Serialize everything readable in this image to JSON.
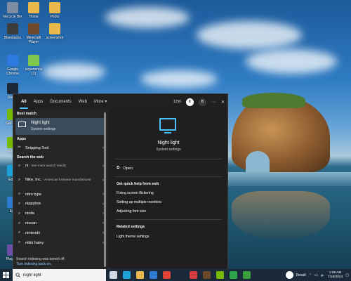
{
  "desktop": {
    "icons": [
      {
        "label": "Recycle Bin",
        "color": "#7d8ea0"
      },
      {
        "label": "Home",
        "color": "#e8b84a"
      },
      {
        "label": "Photo",
        "color": "#e8b84a"
      },
      {
        "label": "Bluestacks",
        "color": "#3c3c3c"
      },
      {
        "label": "Minecraft Player",
        "color": "#6c4a2a"
      },
      {
        "label": "screenshot",
        "color": "#e8b84a"
      },
      {
        "label": "Google Chrome",
        "color": "#2d7be0"
      },
      {
        "label": "experience (1)",
        "color": "#7ec850"
      },
      {
        "label": "Steam",
        "color": "#1b2838"
      },
      {
        "label": "GeForce",
        "color": "#76b900"
      },
      {
        "label": "Nvidia",
        "color": "#76b900"
      },
      {
        "label": "Edge",
        "color": "#1da1d6"
      },
      {
        "label": "Edit",
        "color": "#2f7bd1"
      },
      {
        "label": "Play Kin",
        "color": "#6b4fa5"
      }
    ]
  },
  "search_panel": {
    "tabs": [
      "All",
      "Apps",
      "Documents",
      "Web",
      "More"
    ],
    "more_chevron": "▾",
    "points": "1256",
    "profile_initial": "B",
    "more_options": "···",
    "close": "✕",
    "best_match_heading": "Best match",
    "best_match": {
      "title": "Night light",
      "subtitle": "System settings"
    },
    "apps_heading": "Apps",
    "apps": [
      {
        "label": "Snipping Tool"
      }
    ],
    "web_heading": "Search the web",
    "web_results": [
      {
        "label": "ni",
        "sub": " - See more search results"
      },
      {
        "label": "Nike, Inc.",
        "sub": " - American footwear manufacturer"
      },
      {
        "label": "nitro type",
        "sub": ""
      },
      {
        "label": "nippybox",
        "sub": ""
      },
      {
        "label": "ninite",
        "sub": ""
      },
      {
        "label": "nissan",
        "sub": ""
      },
      {
        "label": "nintendo",
        "sub": ""
      },
      {
        "label": "nikki haley",
        "sub": ""
      }
    ],
    "index_note": "Search indexing was turned off.",
    "index_link": "Turn indexing back on.",
    "preview": {
      "title": "Night light",
      "subtitle": "System settings",
      "open": "Open",
      "quick_help_heading": "Get quick help from web",
      "quick_help": [
        "Fixing screen flickering",
        "Setting up multiple monitors",
        "Adjusting font size"
      ],
      "related_heading": "Related settings",
      "related": [
        "Light theme settings"
      ]
    }
  },
  "taskbar": {
    "search_value": "night light",
    "apps": [
      {
        "name": "task-view",
        "color": "#cfd8e3"
      },
      {
        "name": "edge",
        "color": "#1da1d6"
      },
      {
        "name": "file-explorer",
        "color": "#e8b84a"
      },
      {
        "name": "store",
        "color": "#2f7bd1"
      },
      {
        "name": "chrome",
        "color": "#e34133"
      },
      {
        "name": "steam",
        "color": "#1b2838"
      },
      {
        "name": "media",
        "color": "#d23c3c"
      },
      {
        "name": "minecraft",
        "color": "#6c4a2a"
      },
      {
        "name": "nvidia",
        "color": "#76b900"
      },
      {
        "name": "xbox",
        "color": "#2da548"
      },
      {
        "name": "app-green",
        "color": "#39a03d"
      }
    ],
    "tray_app": "Result",
    "time": "1:06 AM",
    "date": "7/16/2024"
  }
}
